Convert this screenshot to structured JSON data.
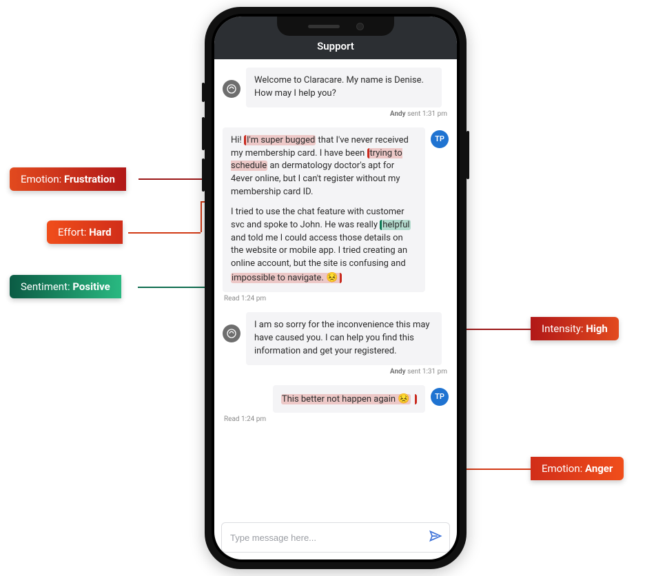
{
  "header": {
    "title": "Support"
  },
  "avatars": {
    "agent_alt": "agent",
    "user_initials": "TP"
  },
  "messages": {
    "m1": {
      "text": "Welcome to Claracare. My name is Denise. How may I help you?",
      "meta_name": "Andy",
      "meta_rest": " sent 1:31 pm"
    },
    "m2": {
      "p1_pre": "Hi! ",
      "p1_hl1": "I'm super bugged",
      "p1_mid": " that I've never received my membership card. I have been ",
      "p1_hl2": "trying to schedule",
      "p1_post": " an dermatology doctor's apt for 4ever online, but I can't register without my membership card ID.",
      "p2_pre": "I tried to use the chat feature with customer svc and spoke to John. He was really ",
      "p2_hl": "helpful",
      "p2_mid": " and told me I could access those details on the website or mobile app. I tried creating an online account,  but the site is confusing and ",
      "p2_hl2": "impossible to navigate.",
      "p2_emoji": " 😣",
      "meta": "Read 1:24 pm"
    },
    "m3": {
      "text": "I am so sorry for the inconvenience this may have caused you. I can help you find this information and get your registered.",
      "meta_name": "Andy",
      "meta_rest": " sent 1:31 pm"
    },
    "m4": {
      "text": "This better not happen again ",
      "emoji": "😣",
      "meta": "Read 1:24 pm"
    }
  },
  "composer": {
    "placeholder": "Type message here..."
  },
  "callouts": {
    "emotion_frustration": {
      "label": "Emotion: ",
      "value": "Frustration"
    },
    "effort_hard": {
      "label": "Effort: ",
      "value": "Hard"
    },
    "sentiment_positive": {
      "label": "Sentiment: ",
      "value": "Positive"
    },
    "intensity_high": {
      "label": "Intensity: ",
      "value": "High"
    },
    "emotion_anger": {
      "label": "Emotion: ",
      "value": "Anger"
    }
  }
}
